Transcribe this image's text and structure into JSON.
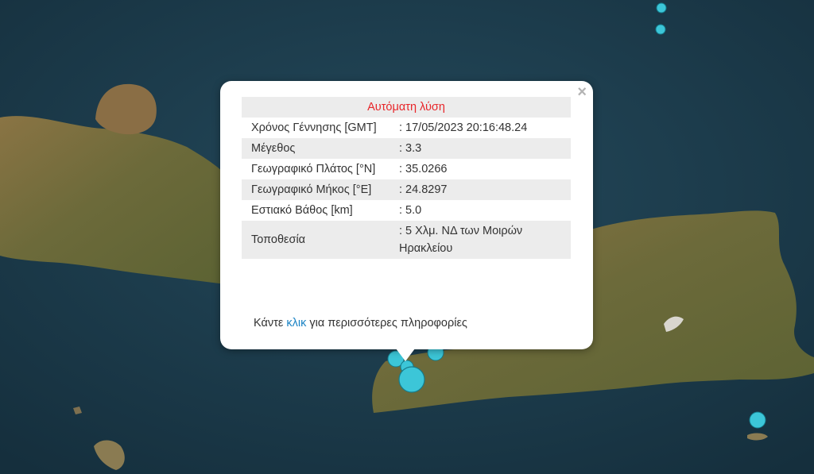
{
  "map": {
    "colors": {
      "sea": "#1d3a4a",
      "land": "#7a6a3c",
      "marker": "#3cc6d8"
    }
  },
  "popup": {
    "title": "Αυτόματη λύση",
    "close_icon": "×",
    "rows": [
      {
        "label": "Χρόνος Γέννησης [GMT]",
        "value": ": 17/05/2023 20:16:48.24"
      },
      {
        "label": "Μέγεθος",
        "value": ": 3.3"
      },
      {
        "label": "Γεωγραφικό Πλάτος [°N]",
        "value": ": 35.0266"
      },
      {
        "label": "Γεωγραφικό Μήκος [°E]",
        "value": ": 24.8297"
      },
      {
        "label": "Εστιακό Βάθος [km]",
        "value": ": 5.0"
      },
      {
        "label": "Τοποθεσία",
        "value": ": 5 Χλμ. ΝΔ των Μοιρών Ηρακλείου"
      }
    ],
    "more_prefix": "Κάντε ",
    "more_link": "κλικ",
    "more_suffix": " για περισσότερες πληροφορίες",
    "title_color": "#e8262a",
    "link_color": "#1b83c4"
  }
}
